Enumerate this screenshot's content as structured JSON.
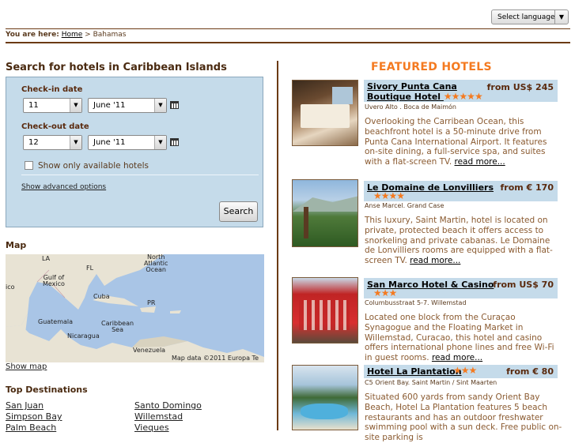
{
  "language": {
    "label": "Select language"
  },
  "breadcrumb": {
    "prefix": "You are here:",
    "home": "Home",
    "sep": ">",
    "current": "Bahamas"
  },
  "search": {
    "title": "Search for hotels in Caribbean Islands",
    "checkin_label": "Check-in date",
    "checkin_day": "11",
    "checkin_month": "June '11",
    "checkout_label": "Check-out date",
    "checkout_day": "12",
    "checkout_month": "June '11",
    "available_label": "Show only available hotels",
    "advanced_label": "Show advanced options",
    "button": "Search"
  },
  "map": {
    "title": "Map",
    "labels": {
      "la": "LA",
      "fl": "FL",
      "gulf": "Gulf of\nMexico",
      "atlantic": "North\nAtlantic\nOcean",
      "cuba": "Cuba",
      "pr": "PR",
      "guatemala": "Guatemala",
      "caribbean": "Caribbean\nSea",
      "nicaragua": "Nicaragua",
      "venezuela": "Venezuela",
      "mexico": "ico"
    },
    "attribution": "Map data ©2011 Europa Te",
    "show_link": "Show map"
  },
  "destinations": {
    "title": "Top Destinations",
    "col1": [
      "San Juan",
      "Simpson Bay",
      "Palm Beach"
    ],
    "col2": [
      "Santo Domingo",
      "Willemstad",
      "Vieques"
    ]
  },
  "featured": {
    "title": "FEATURED HOTELS",
    "hotels": [
      {
        "name": "Sivory Punta Cana Boutique Hotel",
        "stars": "★★★★★",
        "price": "from US$ 245",
        "location": "Uvero Alto . Boca de Maimón",
        "desc": "Overlooking the Carribean Ocean, this beachfront hotel is a 50-minute drive from Punta Cana International Airport. It features on-site dining, a full-service spa, and suites with a flat-screen TV.",
        "more": "read more..."
      },
      {
        "name": "Le Domaine de Lonvilliers",
        "stars": "★★★★",
        "price": "from € 170",
        "location": "Anse Marcel. Grand Case",
        "desc": "This luxury, Saint Martin, hotel is located on private, protected beach it offers access to snorkeling and private cabanas. Le Domaine de Lonvilliers rooms are equipped with a flat-screen TV.",
        "more": "read more..."
      },
      {
        "name": "San Marco Hotel & Casino",
        "stars": "★★★",
        "price": "from US$ 70",
        "location": "Columbusstraat 5-7. Willemstad",
        "desc": "Located one block from the Curaçao Synagogue and the Floating Market in Willemstad, Curacao, this hotel and casino offers international phone lines and free Wi-Fi in guest rooms.",
        "more": "read more..."
      },
      {
        "name": "Hotel La Plantation",
        "stars": "★★★",
        "price": "from € 80",
        "location": "C5 Orient Bay. Saint Martin / Sint Maarten",
        "desc": "Situated 600 yards from sandy Orient Bay Beach, Hotel La Plantation features 5 beach restaurants and has an outdoor freshwater swimming pool with a sun deck. Free public on-site parking is",
        "more": ""
      }
    ]
  }
}
